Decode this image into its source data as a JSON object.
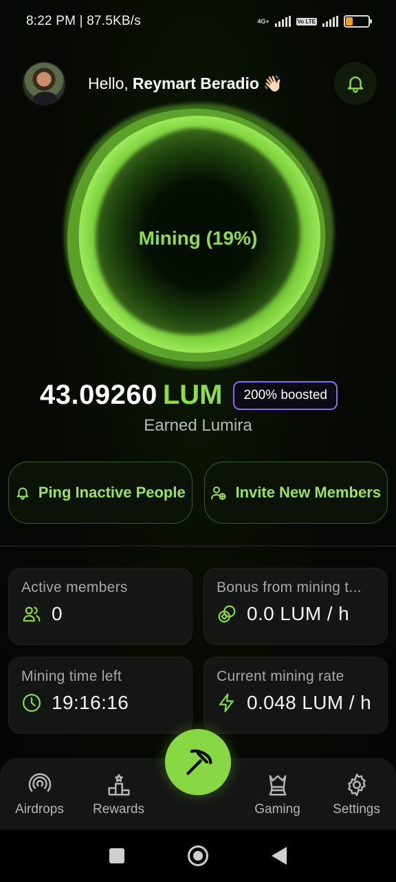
{
  "status_bar": {
    "time": "8:22 PM",
    "speed": "87.5KB/s",
    "network": "4G+",
    "volte": "Vo LTE",
    "battery": "29"
  },
  "header": {
    "greeting_prefix": "Hello,",
    "user_name": "Reymart Beradio",
    "wave_emoji": "👋🏻"
  },
  "mining": {
    "label": "Mining (19%)"
  },
  "balance": {
    "amount": "43.09260",
    "unit": "LUM",
    "boost": "200% boosted",
    "caption": "Earned Lumira"
  },
  "actions": {
    "ping_label": "Ping Inactive People",
    "invite_label": "Invite New Members"
  },
  "stats": [
    {
      "title": "Active members",
      "value": "0",
      "icon": "members-icon"
    },
    {
      "title": "Bonus from mining t...",
      "value": "0.0 LUM / h",
      "icon": "coins-icon"
    },
    {
      "title": "Mining time left",
      "value": "19:16:16",
      "icon": "clock-icon"
    },
    {
      "title": "Current mining rate",
      "value": "0.048 LUM / h",
      "icon": "lightning-icon"
    }
  ],
  "nav": {
    "airdrops": "Airdrops",
    "rewards": "Rewards",
    "gaming": "Gaming",
    "settings": "Settings"
  },
  "colors": {
    "accent": "#86d845",
    "boost_border": "#8a6cf0",
    "card": "#141614"
  }
}
